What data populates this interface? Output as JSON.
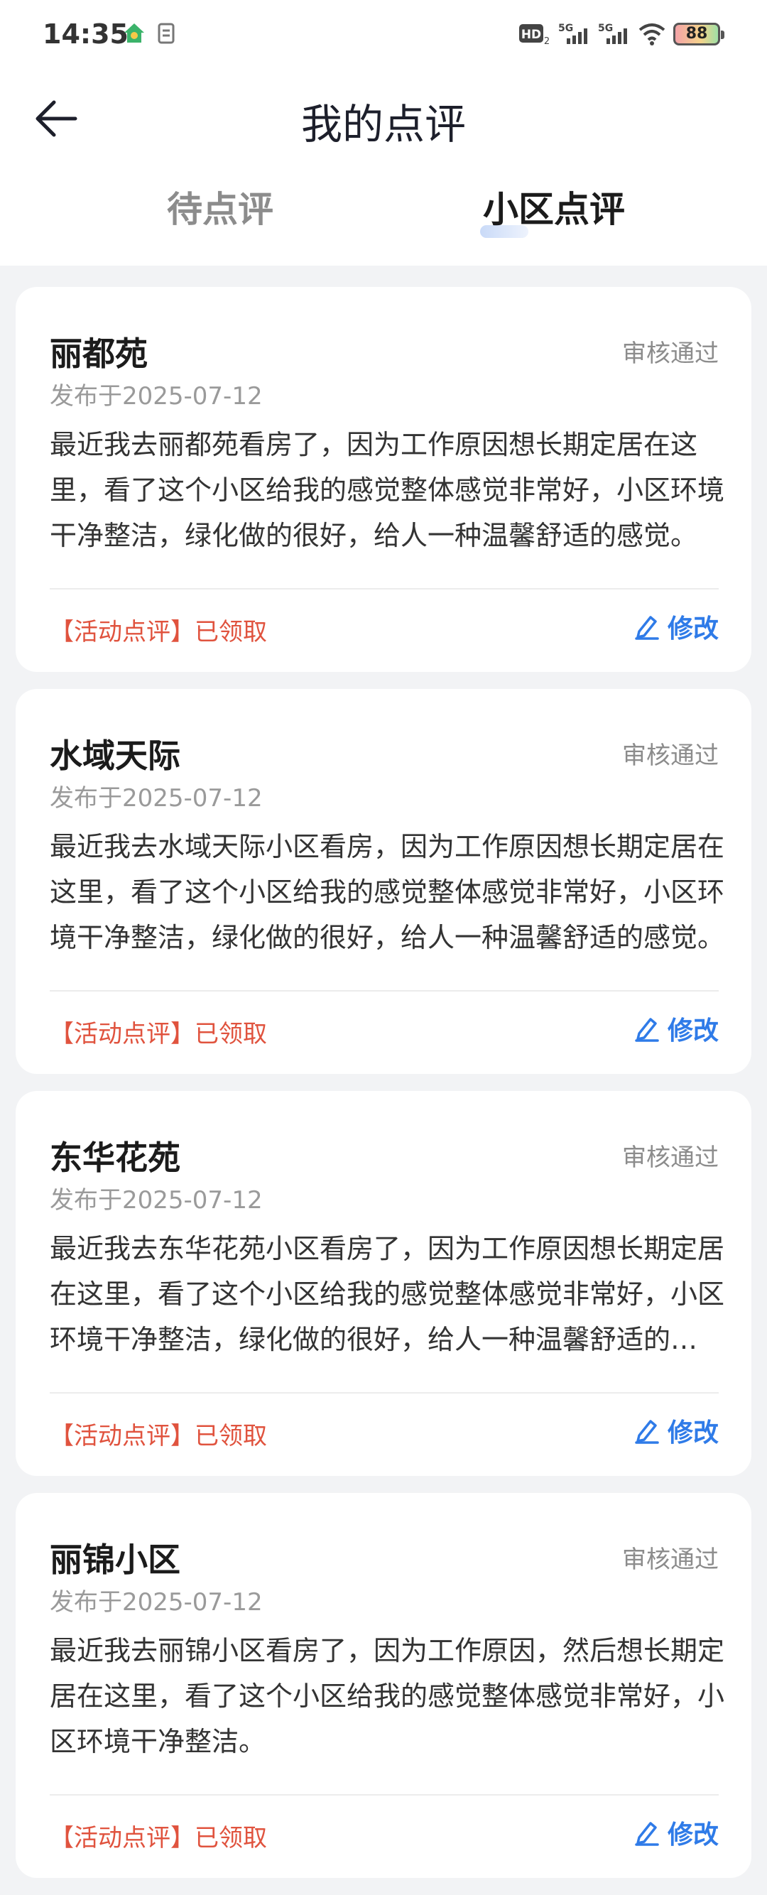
{
  "status_bar": {
    "time": "14:35",
    "battery": "88",
    "icons": [
      "app-notification-icon",
      "document-icon",
      "hd-icon",
      "signal-5g-icon",
      "signal-5g-icon",
      "wifi-icon"
    ]
  },
  "header": {
    "title": "我的点评"
  },
  "tabs": [
    {
      "label": "待点评",
      "active": false
    },
    {
      "label": "小区点评",
      "active": true
    }
  ],
  "reviews": [
    {
      "name": "丽都苑",
      "status": "审核通过",
      "date": "发布于2025-07-12",
      "content": "最近我去丽都苑看房了，因为工作原因想长期定居在这里，看了这个小区给我的感觉整体感觉非常好，小区环境干净整洁，绿化做的很好，给人一种温馨舒适的感觉。",
      "tag": "【活动点评】已领取",
      "edit_label": "修改"
    },
    {
      "name": "水域天际",
      "status": "审核通过",
      "date": "发布于2025-07-12",
      "content": "最近我去水域天际小区看房，因为工作原因想长期定居在这里，看了这个小区给我的感觉整体感觉非常好，小区环境干净整洁，绿化做的很好，给人一种温馨舒适的感觉。",
      "tag": "【活动点评】已领取",
      "edit_label": "修改"
    },
    {
      "name": "东华花苑",
      "status": "审核通过",
      "date": "发布于2025-07-12",
      "content": "最近我去东华花苑小区看房了，因为工作原因想长期定居在这里，看了这个小区给我的感觉整体感觉非常好，小区环境干净整洁，绿化做的很好，给人一种温馨舒适的感觉。",
      "tag": "【活动点评】已领取",
      "edit_label": "修改"
    },
    {
      "name": "丽锦小区",
      "status": "审核通过",
      "date": "发布于2025-07-12",
      "content": "最近我去丽锦小区看房了，因为工作原因，然后想长期定居在这里，看了这个小区给我的感觉整体感觉非常好，小区环境干净整洁。",
      "tag": "【活动点评】已领取",
      "edit_label": "修改"
    }
  ],
  "colors": {
    "accent": "#2f7be8",
    "tag_red": "#e0533e",
    "background": "#f2f3f5"
  }
}
